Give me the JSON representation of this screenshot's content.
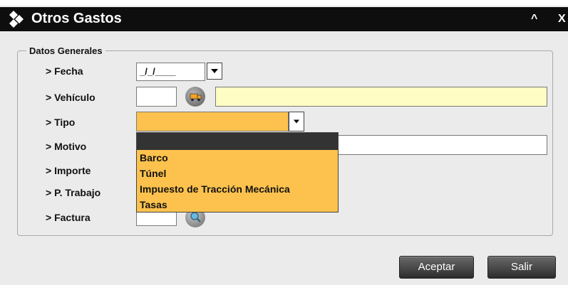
{
  "window": {
    "title": "Otros Gastos",
    "minimize_label": "^",
    "close_label": "X"
  },
  "group": {
    "legend": "Datos Generales"
  },
  "fields": {
    "fecha_label": "> Fecha",
    "fecha_value": "_/_/____",
    "vehiculo_label": "> Vehículo",
    "vehiculo_code": "",
    "vehiculo_desc": "",
    "tipo_label": "> Tipo",
    "tipo_value": "",
    "motivo_label": "> Motivo",
    "motivo_value": "",
    "importe_label": "> Importe",
    "trabajo_label": "> P. Trabajo",
    "factura_label": "> Factura",
    "factura_value": ""
  },
  "tipo_options": [
    "",
    "Barco",
    "Túnel",
    "Impuesto de Tracción Mecánica",
    "Tasas"
  ],
  "buttons": {
    "accept": "Aceptar",
    "exit": "Salir"
  },
  "colors": {
    "titlebar": "#0e0e0e",
    "background": "#ebebeb",
    "selected_field": "#fdc24d",
    "readonly_field": "#fefdc4"
  },
  "icons": [
    "diamond-logo-icon",
    "truck-search-icon",
    "dropdown-arrow-icon",
    "search-icon"
  ]
}
